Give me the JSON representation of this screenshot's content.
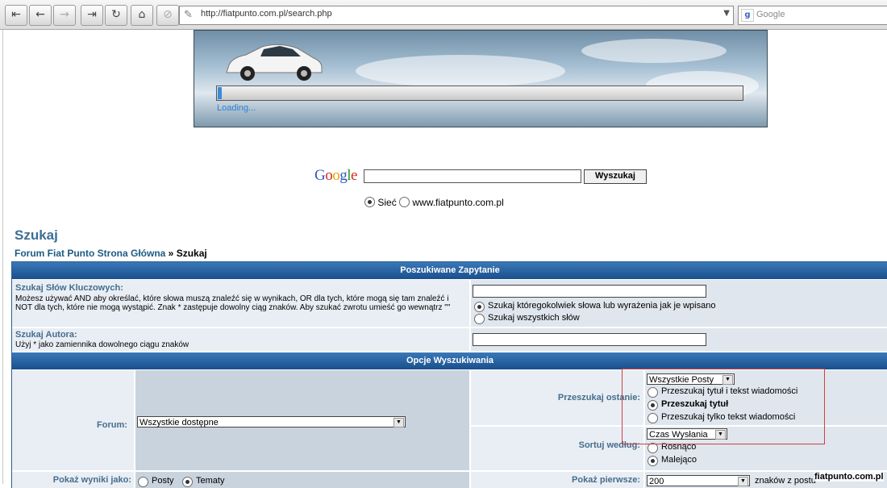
{
  "browser": {
    "url": "http://fiatpunto.com.pl/search.php",
    "search_placeholder": "Google",
    "search_engine_icon": "google-g-icon"
  },
  "banner": {
    "loading_text": "Loading..."
  },
  "google": {
    "logo": [
      "G",
      "o",
      "o",
      "g",
      "l",
      "e"
    ],
    "button": "Wyszukaj",
    "radio_web": "Sieć",
    "radio_site": "www.fiatpunto.com.pl"
  },
  "page": {
    "title": "Szukaj",
    "breadcrumb_link": "Forum Fiat Punto Strona Główna",
    "breadcrumb_sep": " » ",
    "breadcrumb_current": "Szukaj"
  },
  "query_section": {
    "header": "Poszukiwane Zapytanie",
    "keywords_label": "Szukaj Słów Kluczowych:",
    "keywords_help": "Możesz używać AND aby określać, które słowa muszą znaleźć się w wynikach, OR dla tych, które mogą się tam znaleźć i NOT dla tych, które nie mogą wystąpić. Znak * zastępuje dowolny ciąg znaków. Aby szukać zwrotu umieść go wewnątrz \"\"",
    "option_any": "Szukaj któregokolwiek słowa lub wyrażenia jak je wpisano",
    "option_all": "Szukaj wszystkich słów",
    "author_label": "Szukaj Autora:",
    "author_help": "Użyj * jako zamiennika dowolnego ciągu znaków"
  },
  "options_section": {
    "header": "Opcje Wyszukiwania",
    "forum_label": "Forum:",
    "forum_value": "Wszystkie dostępne",
    "search_in_label": "Przeszukaj ostanie:",
    "posts_value": "Wszystkie Posty",
    "search_title_and_text": "Przeszukaj tytuł i tekst wiadomości",
    "search_title": "Przeszukaj tytuł",
    "search_text_only": "Przeszukaj tylko tekst wiadomości",
    "sort_label": "Sortuj według:",
    "sort_value": "Czas Wysłania",
    "sort_asc": "Rosnąco",
    "sort_desc": "Malejąco",
    "show_results_label": "Pokaż wyniki jako:",
    "show_posts": "Posty",
    "show_topics": "Tematy",
    "return_label": "Pokaż pierwsze:",
    "return_value": "200",
    "return_suffix": "znaków z postu"
  },
  "watermark": "fiatpunto.com.pl"
}
